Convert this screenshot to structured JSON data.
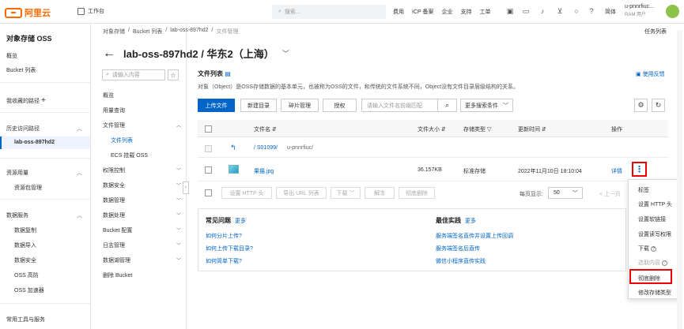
{
  "topbar": {
    "brand": "阿里云",
    "workspace": "工作台",
    "search_placeholder": "搜索...",
    "nav": [
      "费用",
      "ICP 备案",
      "企业",
      "支持",
      "工单"
    ],
    "lang": "简体",
    "user": "u-pnnrfiuc...",
    "user_sub": "RAM 用户"
  },
  "sidebar": {
    "title": "对象存储 OSS",
    "overview": "概览",
    "bucket_list": "Bucket 列表",
    "my_paths": "我收藏的路径",
    "history": "历史访问路径",
    "history_item": "lab-oss-897hd2",
    "resources": "资源用量",
    "resource_pack": "资源包管理",
    "data_services": "数据服务",
    "ds_items": [
      "数据复制",
      "数据导入",
      "数据安全",
      "OSS 高防",
      "OSS 加速器"
    ],
    "tools": "常用工具与服务"
  },
  "subnav": {
    "search_placeholder": "请输入内容",
    "overview": "概览",
    "usage": "用量查询",
    "file_mgmt": "文件管理",
    "file_list": "文件列表",
    "ecs_mount": "ECS 挂载 OSS",
    "items": [
      "权限控制",
      "数据安全",
      "数据管理",
      "数据处理",
      "Bucket 配置",
      "日志管理",
      "数据湖管理"
    ],
    "delete_bucket": "删除 Bucket"
  },
  "breadcrumb": [
    "对象存储",
    "Bucket 列表",
    "lab-oss-897hd2",
    "文件管理"
  ],
  "tasks": "任务列表",
  "page_title": "lab-oss-897hd2 / 华东2（上海）",
  "panel": {
    "title": "文件列表",
    "help": "使用反馈",
    "description": "对象（Object）是OSS存储数据的基本单元，也被称为OSS的文件，和传统的文件系统不同，Object没有文件目录层级结构的关系。",
    "buttons": {
      "upload": "上传文件",
      "new_dir": "新建目录",
      "fragments": "碎片管理",
      "auth": "授权"
    },
    "file_search_placeholder": "请输入文件名前缀匹配",
    "more_search": "更多搜索条件"
  },
  "table": {
    "headers": {
      "name": "文件名",
      "size": "文件大小",
      "storage": "存储类型",
      "updated": "更新时间",
      "ops": "操作"
    },
    "parent_row": {
      "path": "/ S01099/",
      "rest": "u-pnnrfiuc/"
    },
    "file_row": {
      "name": "果猫.jpg",
      "size": "36.157KB",
      "storage": "标准存储",
      "updated": "2022年11月10日 18:10:04",
      "detail": "详情"
    }
  },
  "bulk": {
    "buttons": [
      "设置 HTTP 头",
      "导出 URL 列表",
      "下载",
      "解冻",
      "彻底删除"
    ],
    "per_page_label": "每页显示:",
    "per_page": "50",
    "prev": "< 上一页"
  },
  "faq": {
    "title": "常见问题",
    "more": "更多",
    "links": [
      "如何分片上传?",
      "如何上传下载目录?",
      "如何简单下载?"
    ],
    "bp_title": "最佳实践",
    "bp_more": "更多",
    "bp_links": [
      "服务端签名直传并设置上传回调",
      "服务端签名后直传",
      "微信小程序直传实践"
    ]
  },
  "menu": {
    "items": [
      "标签",
      "设置 HTTP 头",
      "设置软链接",
      "设置读写权限",
      "下载",
      "选取内容",
      "彻底删除",
      "修改存储类型"
    ]
  }
}
